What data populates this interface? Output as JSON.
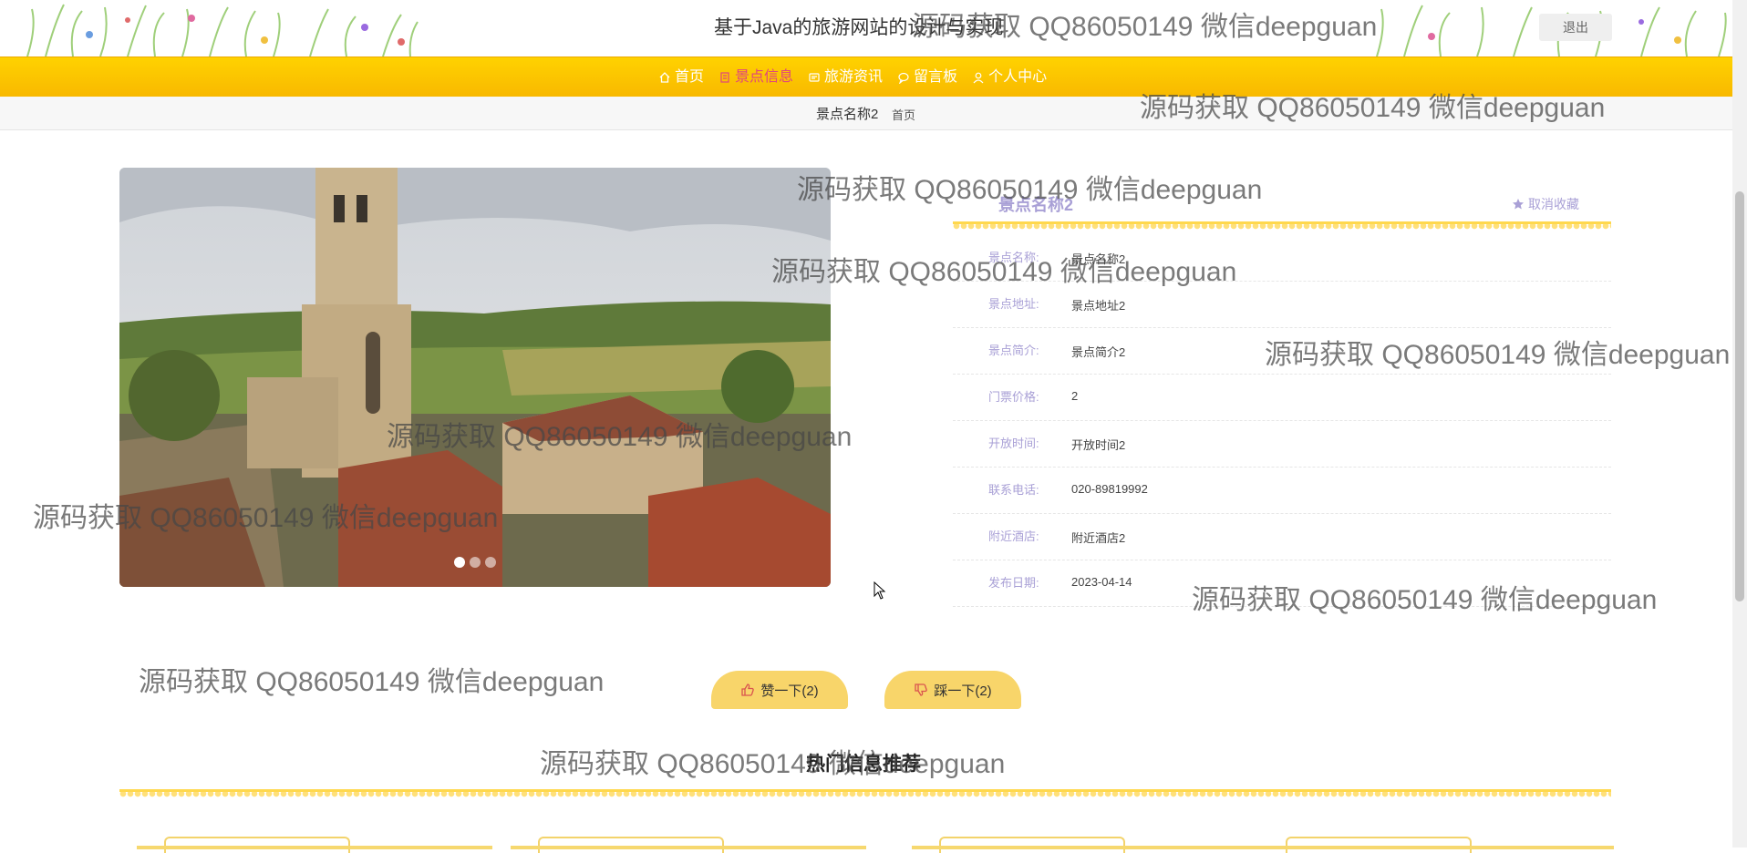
{
  "header": {
    "site_title": "基于Java的旅游网站的设计与实现",
    "logout_label": "退出"
  },
  "nav": {
    "items": [
      {
        "label": "首页",
        "icon": "home-icon",
        "active": false
      },
      {
        "label": "景点信息",
        "icon": "building-icon",
        "active": true
      },
      {
        "label": "旅游资讯",
        "icon": "news-icon",
        "active": false
      },
      {
        "label": "留言板",
        "icon": "chat-icon",
        "active": false
      },
      {
        "label": "个人中心",
        "icon": "user-icon",
        "active": false
      }
    ]
  },
  "breadcrumb": {
    "current": "景点名称2",
    "home": "首页"
  },
  "carousel": {
    "dots": 3,
    "active_dot": 1
  },
  "detail": {
    "title": "景点名称2",
    "favorite_label": "取消收藏",
    "rows": [
      {
        "label": "景点名称:",
        "value": "景点名称2"
      },
      {
        "label": "景点地址:",
        "value": "景点地址2"
      },
      {
        "label": "景点简介:",
        "value": "景点简介2"
      },
      {
        "label": "门票价格:",
        "value": "2"
      },
      {
        "label": "开放时间:",
        "value": "开放时间2"
      },
      {
        "label": "联系电话:",
        "value": "020-89819992"
      },
      {
        "label": "附近酒店:",
        "value": "附近酒店2"
      },
      {
        "label": "发布日期:",
        "value": "2023-04-14"
      }
    ]
  },
  "votes": {
    "up_label": "赞一下(2)",
    "down_label": "踩一下(2)"
  },
  "hot": {
    "title": "热门信息推荐"
  },
  "watermark": "源码获取 QQ86050149 微信deepguan",
  "colors": {
    "nav_bg": "#ffc800",
    "accent_purple": "#a9a0d6",
    "active_pink": "#e0457d",
    "vote_bg": "#f8d56a"
  }
}
